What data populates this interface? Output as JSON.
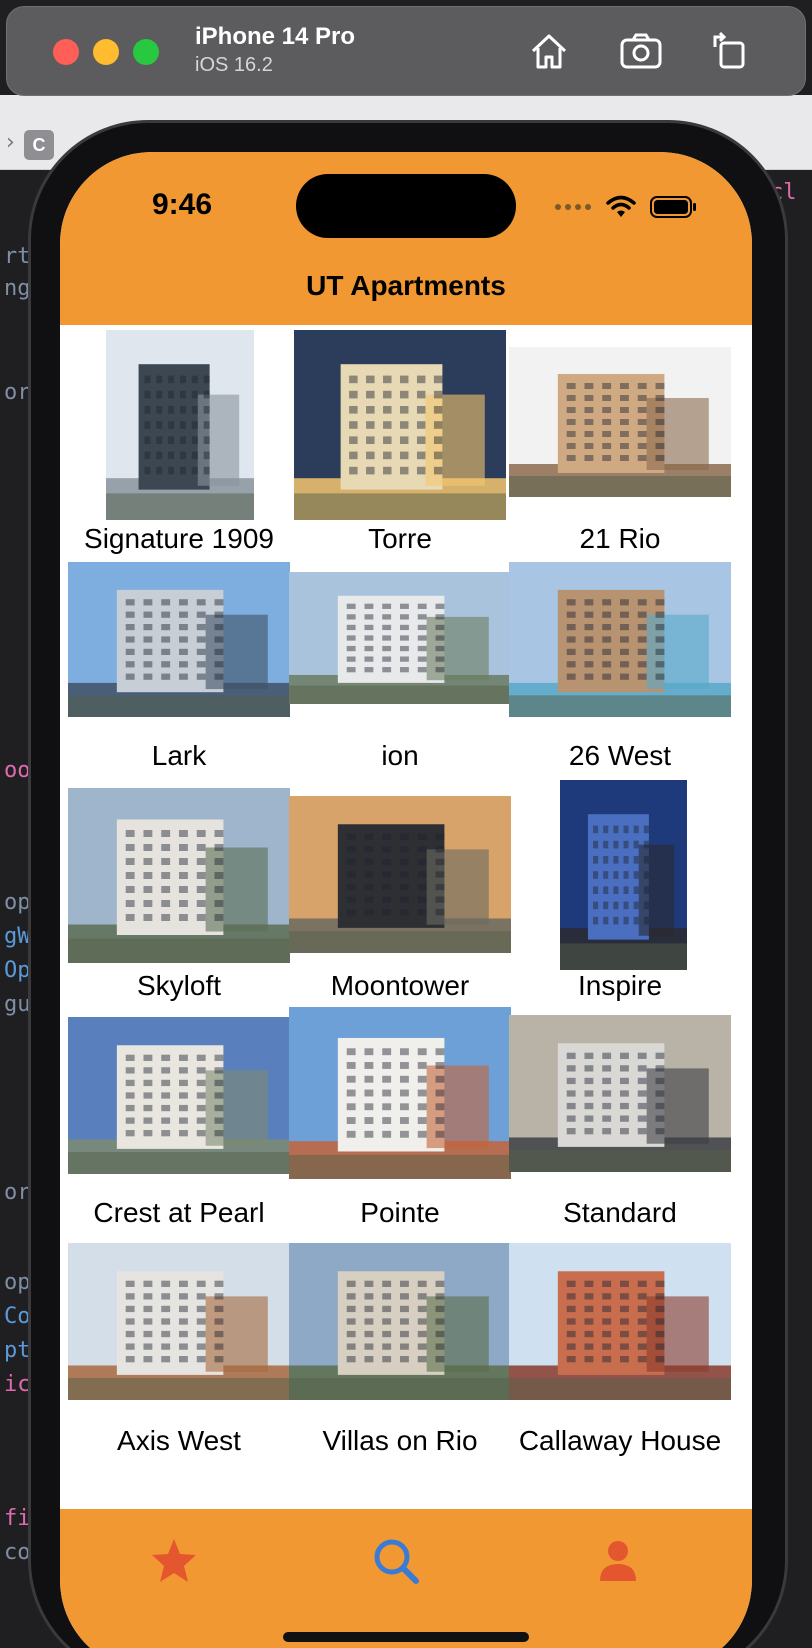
{
  "simulator": {
    "device_name": "iPhone 14 Pro",
    "os_version": "iOS 16.2",
    "buttons": [
      "home-icon",
      "screenshot-icon",
      "rotate-icon"
    ]
  },
  "status_bar": {
    "time": "9:46",
    "icons": [
      "signal-dots-icon",
      "wifi-icon",
      "battery-icon"
    ]
  },
  "nav": {
    "title": "UT Apartments"
  },
  "apartments": [
    {
      "name": "Signature 1909",
      "palette": [
        "#dfe6ee",
        "#3d4752",
        "#8a949e"
      ]
    },
    {
      "name": "Torre",
      "palette": [
        "#2b3d5a",
        "#e8d9b5",
        "#f4c56e"
      ]
    },
    {
      "name": "21 Rio",
      "palette": [
        "#f2f2f2",
        "#cfa982",
        "#8c6b4e"
      ]
    },
    {
      "name": "Lark",
      "palette": [
        "#7eaee0",
        "#c7ced6",
        "#3f5166"
      ]
    },
    {
      "name": "ion",
      "palette": [
        "#a9c3dc",
        "#e8e9ea",
        "#6b7d61"
      ]
    },
    {
      "name": "26 West",
      "palette": [
        "#a8c5e3",
        "#b89372",
        "#59a8c9"
      ]
    },
    {
      "name": "Skyloft",
      "palette": [
        "#9fb5cc",
        "#e6e3de",
        "#5c6e53"
      ]
    },
    {
      "name": "Moontower",
      "palette": [
        "#d8a36a",
        "#2e2f33",
        "#6b6b60"
      ]
    },
    {
      "name": "Inspire",
      "palette": [
        "#1e3a7a",
        "#4a6fc0",
        "#2a2a30"
      ]
    },
    {
      "name": "Crest at Pearl",
      "palette": [
        "#5a7fbd",
        "#e9e6df",
        "#7d8a72"
      ]
    },
    {
      "name": "Pointe",
      "palette": [
        "#6ea0d8",
        "#f0efeb",
        "#c4643a"
      ]
    },
    {
      "name": "Standard",
      "palette": [
        "#b9b2a6",
        "#d9d8d5",
        "#3d3f45"
      ]
    },
    {
      "name": "Axis West",
      "palette": [
        "#d4dee9",
        "#e6e4e0",
        "#a7693e"
      ]
    },
    {
      "name": "Villas on Rio",
      "palette": [
        "#8ea9c6",
        "#d7cfc1",
        "#5a6e4a"
      ]
    },
    {
      "name": "Callaway House",
      "palette": [
        "#cfe0f1",
        "#c96d4f",
        "#8a3a2b"
      ]
    }
  ],
  "tab_bar": {
    "tabs": [
      {
        "icon": "star-icon",
        "selected": false,
        "color": "#e4572e"
      },
      {
        "icon": "search-icon",
        "selected": true,
        "color": "#3a7bd5"
      },
      {
        "icon": "person-icon",
        "selected": false,
        "color": "#e4572e"
      }
    ]
  },
  "colors": {
    "accent": "#f29833",
    "tab_selected": "#3a7bd5",
    "tab_unselected": "#e4572e"
  }
}
